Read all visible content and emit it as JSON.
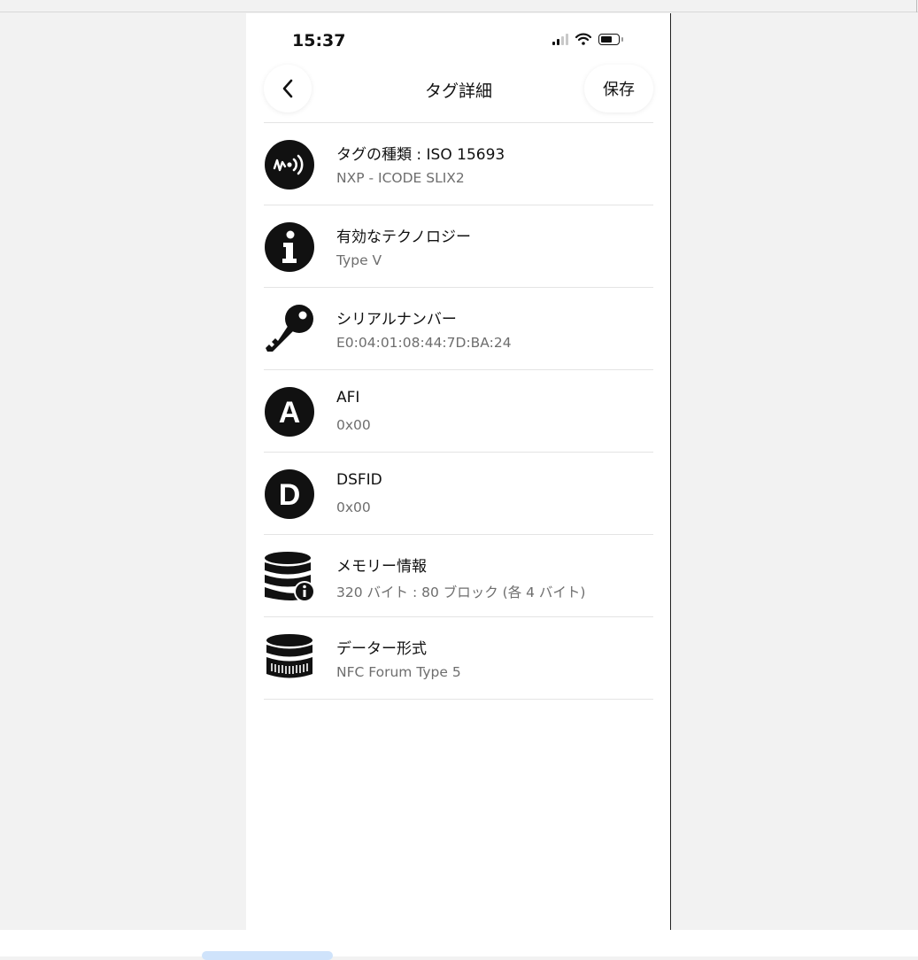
{
  "status_bar": {
    "time": "15:37"
  },
  "nav": {
    "title": "タグ詳細",
    "save_label": "保存"
  },
  "details": [
    {
      "title": "タグの種類 : ISO 15693",
      "value": "NXP - ICODE SLIX2",
      "icon": "nfc-wave-icon"
    },
    {
      "title": "有効なテクノロジー",
      "value": "Type V",
      "icon": "info-icon"
    },
    {
      "title": "シリアルナンバー",
      "value": "E0:04:01:08:44:7D:BA:24",
      "icon": "key-icon"
    },
    {
      "title": "AFI",
      "value": "0x00",
      "icon": "letter-a-icon"
    },
    {
      "title": "DSFID",
      "value": "0x00",
      "icon": "letter-d-icon"
    },
    {
      "title": "メモリー情報",
      "value": "320 バイト : 80 ブロック (各 4 バイト)",
      "icon": "database-info-icon"
    },
    {
      "title": "データー形式",
      "value": "NFC Forum Type 5",
      "icon": "database-format-icon"
    }
  ]
}
